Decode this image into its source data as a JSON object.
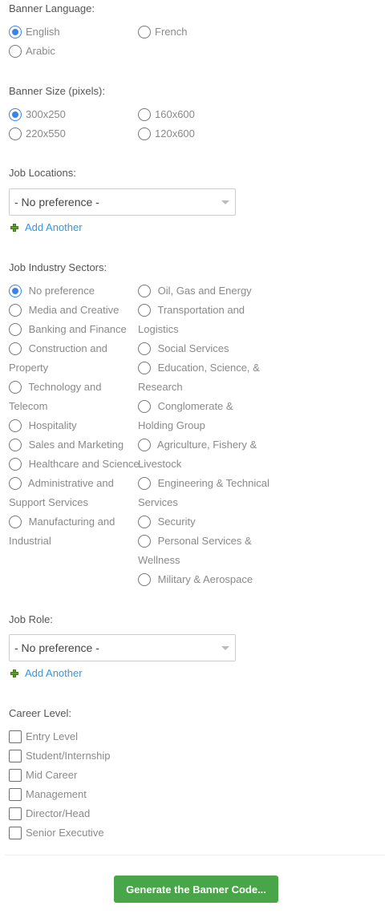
{
  "banner_language": {
    "label": "Banner Language:",
    "options": [
      {
        "label": "English",
        "checked": true
      },
      {
        "label": "French",
        "checked": false
      },
      {
        "label": "Arabic",
        "checked": false
      }
    ]
  },
  "banner_size": {
    "label": "Banner Size (pixels):",
    "options": [
      {
        "label": "300x250",
        "checked": true
      },
      {
        "label": "160x600",
        "checked": false
      },
      {
        "label": "220x550",
        "checked": false
      },
      {
        "label": "120x600",
        "checked": false
      }
    ]
  },
  "job_locations": {
    "label": "Job Locations:",
    "select_value": "- No preference -",
    "add_label": "Add Another"
  },
  "job_industry": {
    "label": "Job Industry Sectors:",
    "left": [
      {
        "label": "No preference",
        "checked": true
      },
      {
        "label": "Media and Creative",
        "checked": false
      },
      {
        "label": "Banking and Finance",
        "checked": false
      },
      {
        "label": "Construction and Property",
        "checked": false
      },
      {
        "label": "Technology and Telecom",
        "checked": false
      },
      {
        "label": "Hospitality",
        "checked": false
      },
      {
        "label": "Sales and Marketing",
        "checked": false
      },
      {
        "label": "Healthcare and Science",
        "checked": false
      },
      {
        "label": "Administrative and Support Services",
        "checked": false
      },
      {
        "label": "Manufacturing and Industrial",
        "checked": false
      }
    ],
    "right": [
      {
        "label": "Oil, Gas and Energy",
        "checked": false
      },
      {
        "label": "Transportation and Logistics",
        "checked": false
      },
      {
        "label": "Social Services",
        "checked": false
      },
      {
        "label": "Education, Science, & Research",
        "checked": false
      },
      {
        "label": "Conglomerate & Holding Group",
        "checked": false
      },
      {
        "label": "Agriculture, Fishery & Livestock",
        "checked": false
      },
      {
        "label": "Engineering & Technical Services",
        "checked": false
      },
      {
        "label": "Security",
        "checked": false
      },
      {
        "label": "Personal Services & Wellness",
        "checked": false
      },
      {
        "label": "Military & Aerospace",
        "checked": false
      }
    ]
  },
  "job_role": {
    "label": "Job Role:",
    "select_value": "- No preference -",
    "add_label": "Add Another"
  },
  "career_level": {
    "label": "Career Level:",
    "options": [
      {
        "label": "Entry Level",
        "checked": false
      },
      {
        "label": "Student/Internship",
        "checked": false
      },
      {
        "label": "Mid Career",
        "checked": false
      },
      {
        "label": "Management",
        "checked": false
      },
      {
        "label": "Director/Head",
        "checked": false
      },
      {
        "label": "Senior Executive",
        "checked": false
      }
    ]
  },
  "generate_button": {
    "label": "Generate the Banner Code..."
  },
  "colors": {
    "accent_radio": "#3c83e6",
    "link": "#3598db",
    "button_bg": "#49a648",
    "plus_icon": "#5fa52a"
  }
}
